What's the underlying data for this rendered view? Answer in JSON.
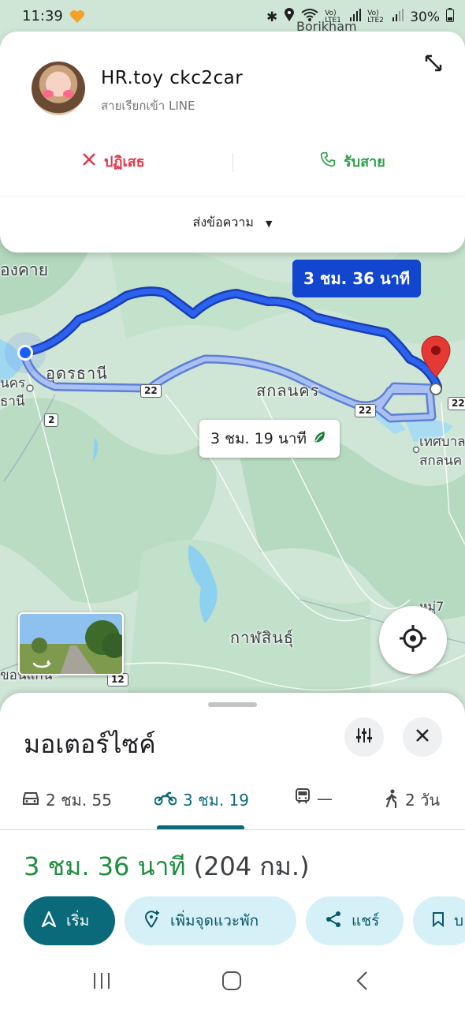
{
  "status_bar": {
    "time": "11:39",
    "battery": "30%",
    "signal_1": "Vo) LTE1",
    "signal_2": "Vo) LTE2",
    "overlay_label": "Borikham"
  },
  "call": {
    "caller_name": "HR.toy ckc2car",
    "subtitle": "สายเรียกเข้า LINE",
    "decline_label": "ปฏิเสธ",
    "accept_label": "รับสาย",
    "message_label": "ส่งข้อความ"
  },
  "map": {
    "labels": {
      "nongkhai": "องคาย",
      "udon": "อุดรธานี",
      "nakhon": "นคร",
      "thani": "ธานี",
      "sakon": "สกลนคร",
      "thesaban": "เทศบาล",
      "sakon2": "สกลนค",
      "kalasin": "กาฬสินธุ์",
      "village": "หมู่7",
      "khon": "ขอนแก่น"
    },
    "shields": {
      "s22a": "22",
      "s22b": "22",
      "s22c": "22",
      "s2": "2",
      "s12": "12"
    },
    "route_main_time": "3 ชม. 36 นาที",
    "route_alt_time": "3 ชม. 19 นาที",
    "colors": {
      "route_main": "#1246cf",
      "route_alt": "#a7bdf0",
      "destination": "#e53935"
    }
  },
  "sheet": {
    "mode_title": "มอเตอร์ไซค์",
    "modes": [
      {
        "icon": "car-icon",
        "label": "2 ชม. 55"
      },
      {
        "icon": "motorcycle-icon",
        "label": "3 ชม. 19"
      },
      {
        "icon": "transit-icon",
        "label": "—"
      },
      {
        "icon": "walk-icon",
        "label": "2 วัน"
      }
    ],
    "summary_duration": "3 ชม. 36 นาที",
    "summary_distance": "(204 กม.)",
    "actions": {
      "start": "เริ่ม",
      "add_stop": "เพิ่มจุดแวะพัก",
      "share": "แชร์",
      "save": "บ"
    }
  }
}
